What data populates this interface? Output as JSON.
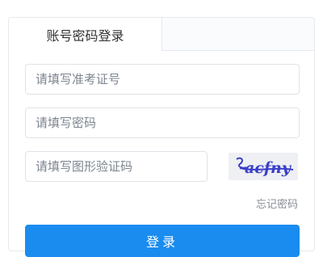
{
  "tabs": {
    "account_login": "账号密码登录"
  },
  "form": {
    "exam_id_placeholder": "请填写准考证号",
    "password_placeholder": "请填写密码",
    "captcha_placeholder": "请填写图形验证码",
    "captcha_text": "acfny"
  },
  "links": {
    "forgot_password": "忘记密码"
  },
  "buttons": {
    "login": "登录"
  },
  "colors": {
    "primary": "#1a8cf0",
    "captcha_text": "#3a3fc8"
  }
}
